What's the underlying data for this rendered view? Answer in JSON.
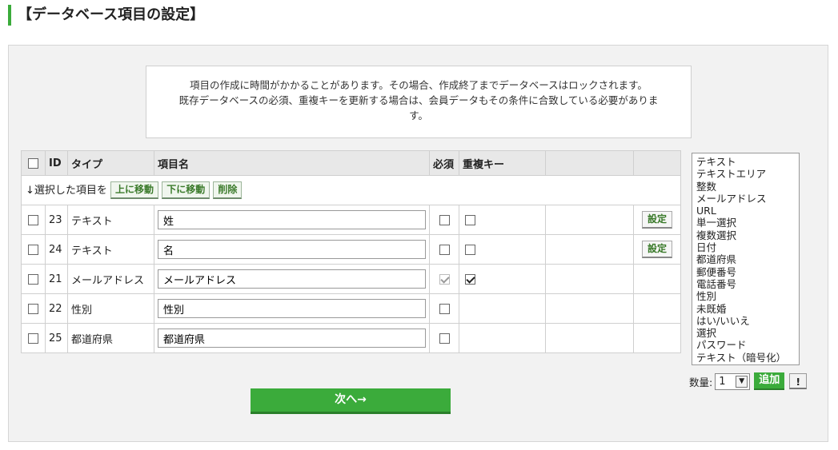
{
  "page": {
    "title": "【データベース項目の設定】"
  },
  "notice": {
    "line1": "項目の作成に時間がかかることがあります。その場合、作成終了までデータベースはロックされます。",
    "line2": "既存データベースの必須、重複キーを更新する場合は、会員データもその条件に合致している必要がありま",
    "line3": "す。"
  },
  "table": {
    "headers": {
      "id": "ID",
      "type": "タイプ",
      "name": "項目名",
      "required": "必須",
      "dupkey": "重複キー"
    },
    "action_row": {
      "label": "↓選択した項目を",
      "move_up": "上に移動",
      "move_down": "下に移動",
      "delete": "削除"
    },
    "config_label": "設定",
    "rows": [
      {
        "id": "23",
        "type": "テキスト",
        "name": "姓"
      },
      {
        "id": "24",
        "type": "テキスト",
        "name": "名"
      },
      {
        "id": "21",
        "type": "メールアドレス",
        "name": "メールアドレス"
      },
      {
        "id": "22",
        "type": "性別",
        "name": "性別"
      },
      {
        "id": "25",
        "type": "都道府県",
        "name": "都道府県"
      }
    ]
  },
  "next_button": "次へ→",
  "type_list": [
    "テキスト",
    "テキストエリア",
    "整数",
    "メールアドレス",
    "URL",
    "単一選択",
    "複数選択",
    "日付",
    "都道府県",
    "郵便番号",
    "電話番号",
    "性別",
    "未既婚",
    "はい/いいえ",
    "選択",
    "パスワード",
    "テキスト（暗号化）"
  ],
  "quantity": {
    "label": "数量:",
    "value": "1",
    "add_label": "追加",
    "help_label": "!"
  },
  "colors": {
    "accent": "#3bab3b"
  }
}
